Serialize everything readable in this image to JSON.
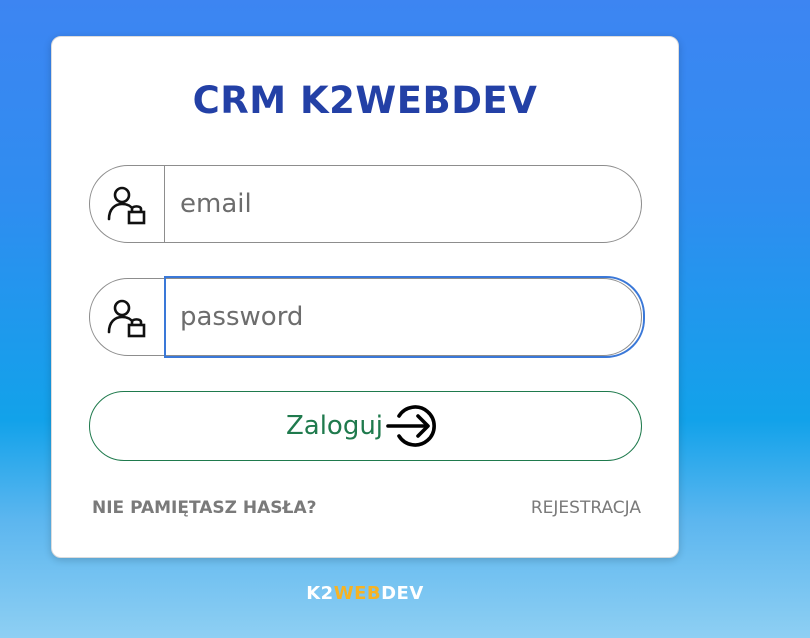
{
  "app": {
    "title": "CRM K2WEBDEV"
  },
  "login_form": {
    "email": {
      "placeholder": "email",
      "value": "",
      "icon": "user-lock-icon"
    },
    "password": {
      "placeholder": "password",
      "value": "",
      "icon": "user-lock-icon",
      "focused": true
    },
    "submit": {
      "label": "Zaloguj",
      "icon": "arrow-right-circle-icon"
    }
  },
  "links": {
    "forgot_password": "NIE PAMIĘTASZ HASŁA?",
    "register": "REJESTRACJA"
  },
  "footer": {
    "logo_part1": "K2",
    "logo_part2": "WEB",
    "logo_part3": "DEV"
  },
  "colors": {
    "title": "#2340a6",
    "submit": "#1f7a4d",
    "focus_ring": "#3a78d8",
    "logo_accent": "#f6b324",
    "link": "#7a7a7a"
  }
}
